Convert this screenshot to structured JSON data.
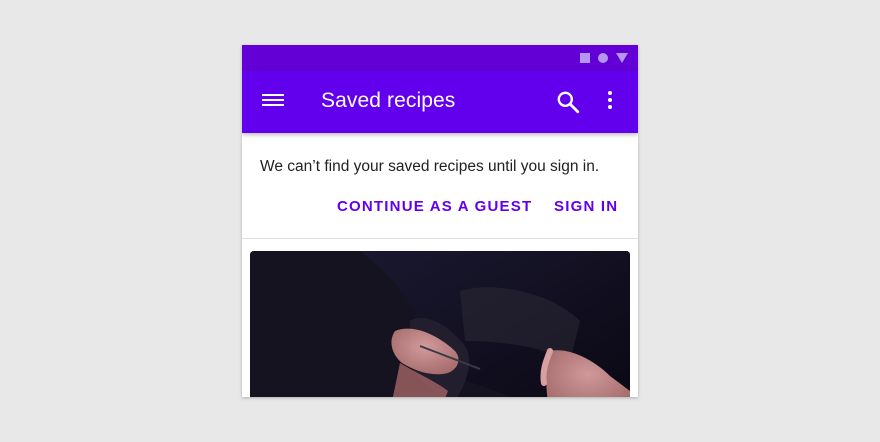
{
  "app": {
    "title": "Saved recipes",
    "accent": "#6200ee",
    "status_bar_color": "#6200d5"
  },
  "status_bar": {
    "icons": [
      "square-icon",
      "circle-icon",
      "triangle-icon"
    ]
  },
  "app_bar": {
    "icons": [
      "menu-icon",
      "search-icon",
      "more-vert-icon"
    ]
  },
  "banner": {
    "message": "We can’t find your saved recipes until you sign in.",
    "actions": {
      "guest": "CONTINUE AS A GUEST",
      "signin": "SIGN IN"
    }
  }
}
